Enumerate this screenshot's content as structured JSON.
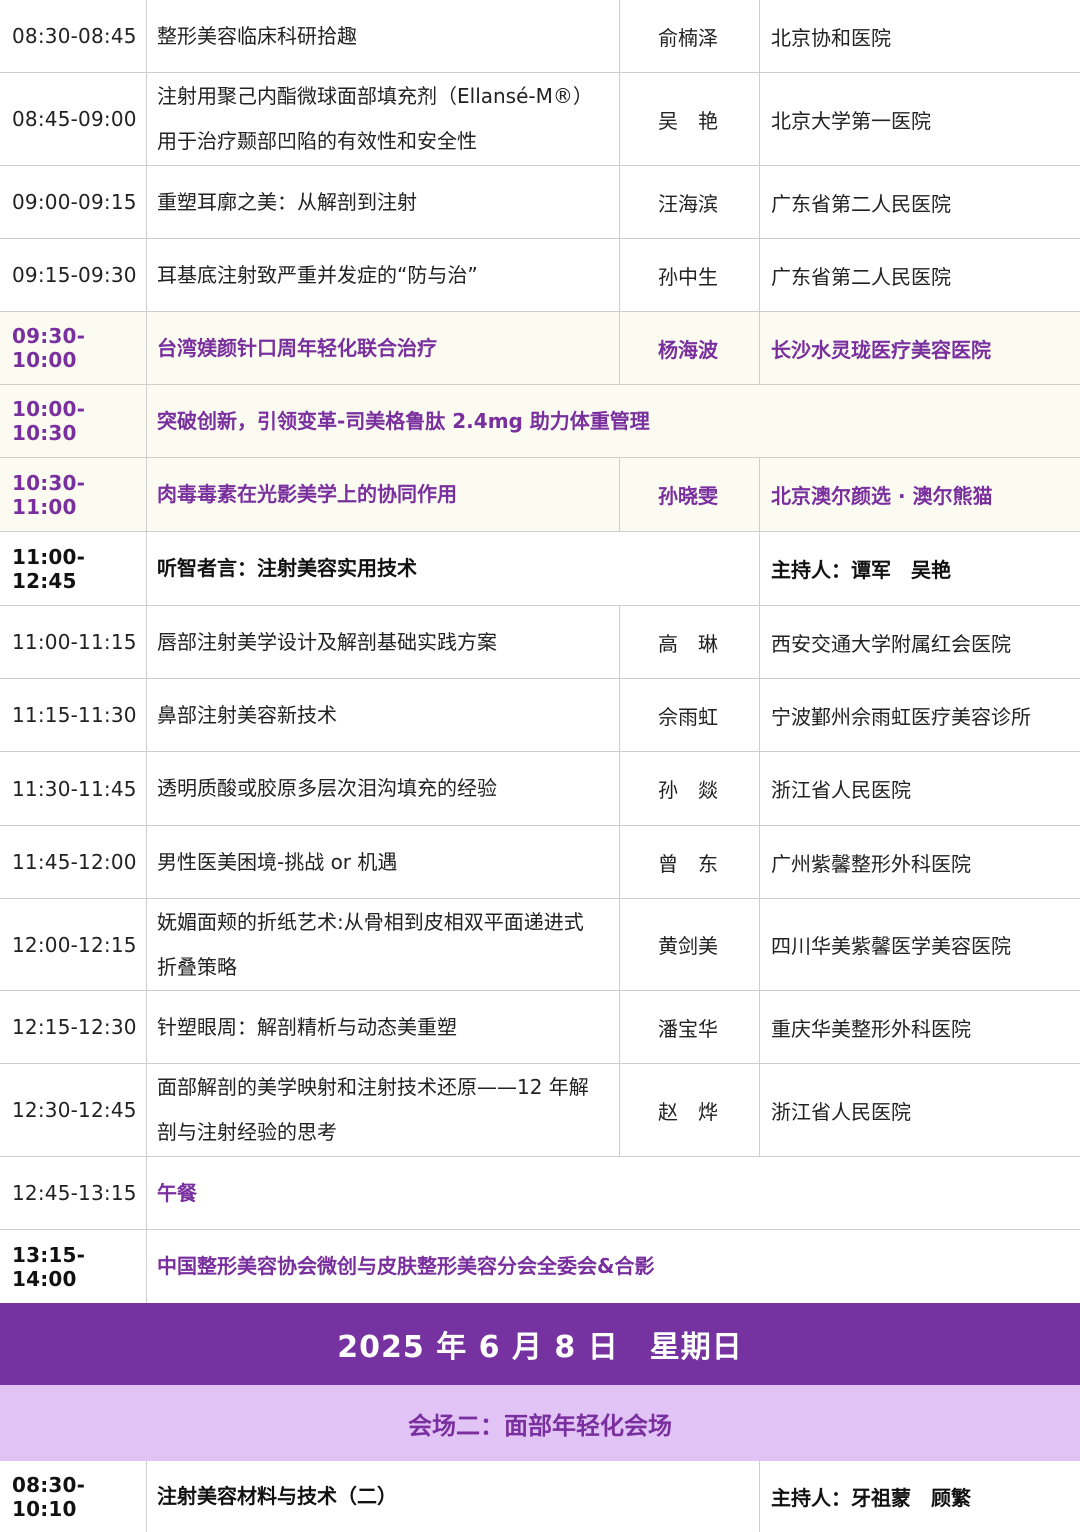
{
  "rows": [
    {
      "time": "08:30-08:45",
      "topic": "整形美容临床科研拾趣",
      "speaker": "俞楠泽",
      "institution": "北京协和医院"
    },
    {
      "time": "08:45-09:00",
      "topic": "注射用聚己内酯微球面部填充剂（Ellansé-M®）\n用于治疗颞部凹陷的有效性和安全性",
      "speaker": "吴　艳",
      "institution": "北京大学第一医院"
    },
    {
      "time": "09:00-09:15",
      "topic": "重塑耳廓之美：从解剖到注射",
      "speaker": "汪海滨",
      "institution": "广东省第二人民医院"
    },
    {
      "time": "09:15-09:30",
      "topic": "耳基底注射致严重并发症的“防与治”",
      "speaker": "孙中生",
      "institution": "广东省第二人民医院"
    },
    {
      "time": "09:30-10:00",
      "topic": "台湾媄颜针口周年轻化联合治疗",
      "speaker": "杨海波",
      "institution": "长沙水灵珑医疗美容医院"
    },
    {
      "time": "10:00-10:30",
      "topic": "突破创新，引领变革-司美格鲁肽 2.4mg 助力体重管理"
    },
    {
      "time": "10:30-11:00",
      "topic": "肉毒毒素在光影美学上的协同作用",
      "speaker": "孙晓雯",
      "institution": "北京澳尔颜选 · 澳尔熊猫"
    },
    {
      "time": "11:00-12:45",
      "topic": "听智者言：注射美容实用技术",
      "host": "主持人：谭军　吴艳"
    },
    {
      "time": "11:00-11:15",
      "topic": "唇部注射美学设计及解剖基础实践方案",
      "speaker": "高　琳",
      "institution": "西安交通大学附属红会医院"
    },
    {
      "time": "11:15-11:30",
      "topic": "鼻部注射美容新技术",
      "speaker": "佘雨虹",
      "institution": "宁波鄞州佘雨虹医疗美容诊所"
    },
    {
      "time": "11:30-11:45",
      "topic": "透明质酸或胶原多层次泪沟填充的经验",
      "speaker": "孙　燚",
      "institution": "浙江省人民医院"
    },
    {
      "time": "11:45-12:00",
      "topic": "男性医美困境-挑战 or 机遇",
      "speaker": "曾　东",
      "institution": "广州紫馨整形外科医院"
    },
    {
      "time": "12:00-12:15",
      "topic": "妩媚面颊的折纸艺术:从骨相到皮相双平面递进式\n折叠策略",
      "speaker": "黄剑美",
      "institution": "四川华美紫馨医学美容医院"
    },
    {
      "time": "12:15-12:30",
      "topic": "针塑眼周：解剖精析与动态美重塑",
      "speaker": "潘宝华",
      "institution": "重庆华美整形外科医院"
    },
    {
      "time": "12:30-12:45",
      "topic": "面部解剖的美学映射和注射技术还原——12 年解\n剖与注射经验的思考",
      "speaker": "赵　烨",
      "institution": "浙江省人民医院"
    },
    {
      "time": "12:45-13:15",
      "topic": "午餐"
    },
    {
      "time": "13:15-14:00",
      "topic": "中国整形美容协会微创与皮肤整形美容分会全委会&合影"
    }
  ],
  "banner_date": "2025 年 6 月 8 日　星期日",
  "banner_venue": "会场二：面部年轻化会场",
  "last_row": {
    "time": "08:30-10:10",
    "topic": "注射美容材料与技术（二）",
    "host": "主持人：牙祖蒙　顾繁"
  },
  "colors": {
    "accent_purple": "#7a2f9e",
    "banner_purple": "#7532a0",
    "venue_lilac": "#e1c3f5",
    "highlight_bg": "#fbfbf1"
  }
}
